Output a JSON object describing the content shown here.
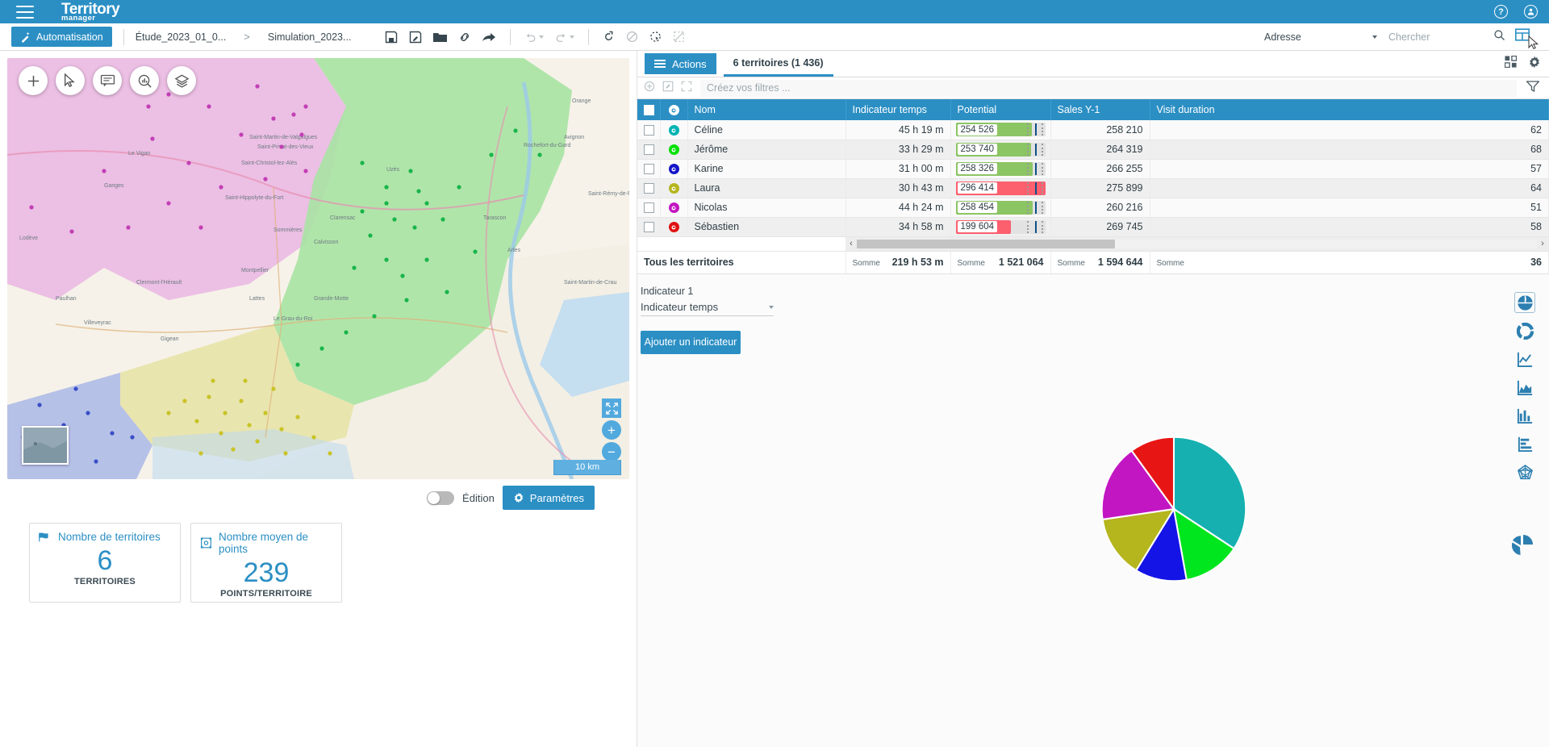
{
  "brand": {
    "name": "Territory",
    "sub": "manager"
  },
  "topbar": {
    "menu_icon": "hamburger-icon",
    "help_icon": "help-icon",
    "account_icon": "account-icon"
  },
  "toolbar": {
    "automation_label": "Automatisation",
    "breadcrumb": [
      "Étude_2023_01_0...",
      "Simulation_2023..."
    ],
    "breadcrumb_separator": ">",
    "icons": [
      "save-icon",
      "save-as-icon",
      "folder-icon",
      "link-icon",
      "share-icon",
      "undo-icon",
      "redo-icon",
      "refresh-icon",
      "forbidden-icon",
      "lasso-select-icon",
      "clear-selection-icon"
    ],
    "address_select_value": "Adresse",
    "search_placeholder": "Chercher",
    "search_value": "",
    "search_icon": "search-icon",
    "layout_icon": "layout-grid-icon"
  },
  "map": {
    "tools": [
      "add-point-icon",
      "cursor-select-icon",
      "comment-icon",
      "search-area-icon",
      "layers-icon"
    ],
    "fullscreen_icon": "fullscreen-icon",
    "zoom_in": "+",
    "zoom_out": "−",
    "scale_label": "10 km",
    "minimap": "minimap-thumbnail"
  },
  "map_footer": {
    "edition_label": "Édition",
    "edition_on": false,
    "params_label": "Paramètres",
    "params_icon": "gear-icon"
  },
  "kpis": [
    {
      "icon": "territory-flag-icon",
      "title": "Nombre de territoires",
      "value": "6",
      "unit": "TERRITOIRES"
    },
    {
      "icon": "points-icon",
      "title": "Nombre moyen de points",
      "value": "239",
      "unit": "POINTS/TERRITOIRE"
    }
  ],
  "panel": {
    "actions_label": "Actions",
    "tab_label": "6 territoires (1 436)",
    "grid_settings_icon": "grid-settings-icon",
    "gear_icon": "gear-icon",
    "filter_placeholder": "Créez vos filtres ...",
    "filter_value": "",
    "filter_icons": [
      "add-filter-icon",
      "edit-filter-icon",
      "expand-filter-icon"
    ],
    "funnel_icon": "funnel-icon"
  },
  "table": {
    "columns": [
      "",
      "",
      "Nom",
      "Indicateur temps",
      "Potential",
      "Sales Y-1",
      "Visit duration"
    ],
    "rows": [
      {
        "name": "Céline",
        "color": "#00b3b3",
        "time": "45 h 19 m",
        "potential": "254 526",
        "potential_pct": 85,
        "potential_state": "good",
        "sales": "258 210",
        "visit": "62"
      },
      {
        "name": "Jérôme",
        "color": "#00e000",
        "time": "33 h 29 m",
        "potential": "253 740",
        "potential_pct": 84,
        "potential_state": "good",
        "sales": "264 319",
        "visit": "68"
      },
      {
        "name": "Karine",
        "color": "#1414c8",
        "time": "31 h 00 m",
        "potential": "258 326",
        "potential_pct": 86,
        "potential_state": "good",
        "sales": "266 255",
        "visit": "57"
      },
      {
        "name": "Laura",
        "color": "#b5b51e",
        "time": "30 h 43 m",
        "potential": "296 414",
        "potential_pct": 100,
        "potential_state": "bad",
        "sales": "275 899",
        "visit": "64"
      },
      {
        "name": "Nicolas",
        "color": "#c216c2",
        "time": "44 h 24 m",
        "potential": "258 454",
        "potential_pct": 86,
        "potential_state": "good",
        "sales": "260 216",
        "visit": "51"
      },
      {
        "name": "Sébastien",
        "color": "#e01111",
        "time": "34 h 58 m",
        "potential": "199 604",
        "potential_pct": 62,
        "potential_state": "bad",
        "sales": "269 745",
        "visit": "58"
      }
    ],
    "summary": {
      "label": "Tous les territoires",
      "word": "Somme",
      "time": "219 h 53 m",
      "potential": "1 521 064",
      "sales": "1 594 644",
      "visit": "36"
    },
    "scroll_left_icon": "chevron-left-icon",
    "scroll_right_icon": "chevron-right-icon"
  },
  "indicator": {
    "title": "Indicateur 1",
    "select_value": "Indicateur temps",
    "add_button": "Ajouter un indicateur"
  },
  "chart_data": {
    "type": "pie",
    "title": "",
    "labels": [
      "Céline",
      "Jérôme",
      "Karine",
      "Laura",
      "Nicolas",
      "Sébastien"
    ],
    "values": [
      45.32,
      33.48,
      31.0,
      30.72,
      44.4,
      34.97
    ],
    "value_unit": "hours",
    "colors": [
      "#16b0b0",
      "#00e61e",
      "#1414e6",
      "#b5b51e",
      "#c216c2",
      "#e81515"
    ],
    "legend": "none",
    "grid": false,
    "start_angle": -90,
    "slice_border": "#ffffff"
  },
  "chart_types": [
    "pie-chart-icon",
    "donut-chart-icon",
    "line-chart-icon",
    "area-chart-icon",
    "bar-chart-icon",
    "horizontal-bar-chart-icon",
    "radar-chart-icon"
  ],
  "selected_chart_type": 0,
  "float_pie_icon": "exploded-pie-icon",
  "colors": {
    "brand": "#2b8fc4",
    "good": "#8cc564",
    "bad": "#fc5f6e",
    "track": "#e2e2e2"
  }
}
